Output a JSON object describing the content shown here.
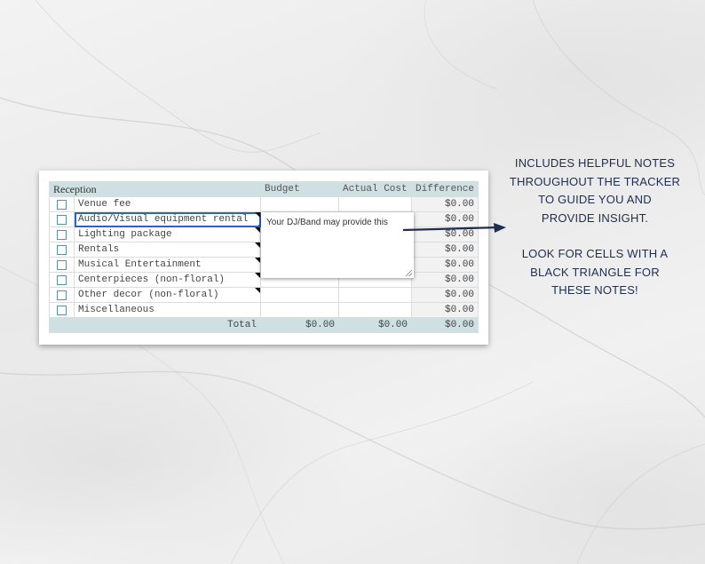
{
  "table": {
    "section_title": "Reception",
    "col_budget": "Budget",
    "col_actual": "Actual Cost",
    "col_difference": "Difference",
    "rows": [
      {
        "label": "Venue fee",
        "difference": "$0.00",
        "has_note": false
      },
      {
        "label": "Audio/Visual equipment rental",
        "difference": "$0.00",
        "has_note": true,
        "selected": true
      },
      {
        "label": "Lighting package",
        "difference": "$0.00",
        "has_note": true
      },
      {
        "label": "Rentals",
        "difference": "$0.00",
        "has_note": true
      },
      {
        "label": "Musical Entertainment",
        "difference": "$0.00",
        "has_note": true
      },
      {
        "label": "Centerpieces (non-floral)",
        "difference": "$0.00",
        "has_note": true
      },
      {
        "label": "Other decor (non-floral)",
        "difference": "$0.00",
        "has_note": true
      },
      {
        "label": "Miscellaneous",
        "difference": "$0.00",
        "has_note": false
      }
    ],
    "total_label": "Total",
    "total_budget": "$0.00",
    "total_actual": "$0.00",
    "total_difference": "$0.00"
  },
  "note_popup": {
    "text": "Your DJ/Band may provide this"
  },
  "callout": {
    "line1": "INCLUDES HELPFUL NOTES",
    "line2": "THROUGHOUT THE TRACKER",
    "line3": "TO GUIDE YOU AND",
    "line4": "PROVIDE INSIGHT.",
    "line5": "LOOK FOR CELLS WITH A",
    "line6": "BLACK TRIANGLE FOR",
    "line7": "THESE NOTES!"
  },
  "colors": {
    "header_bg": "#cfe0e3",
    "selection": "#2962c8",
    "callout_text": "#1f2e4e"
  }
}
